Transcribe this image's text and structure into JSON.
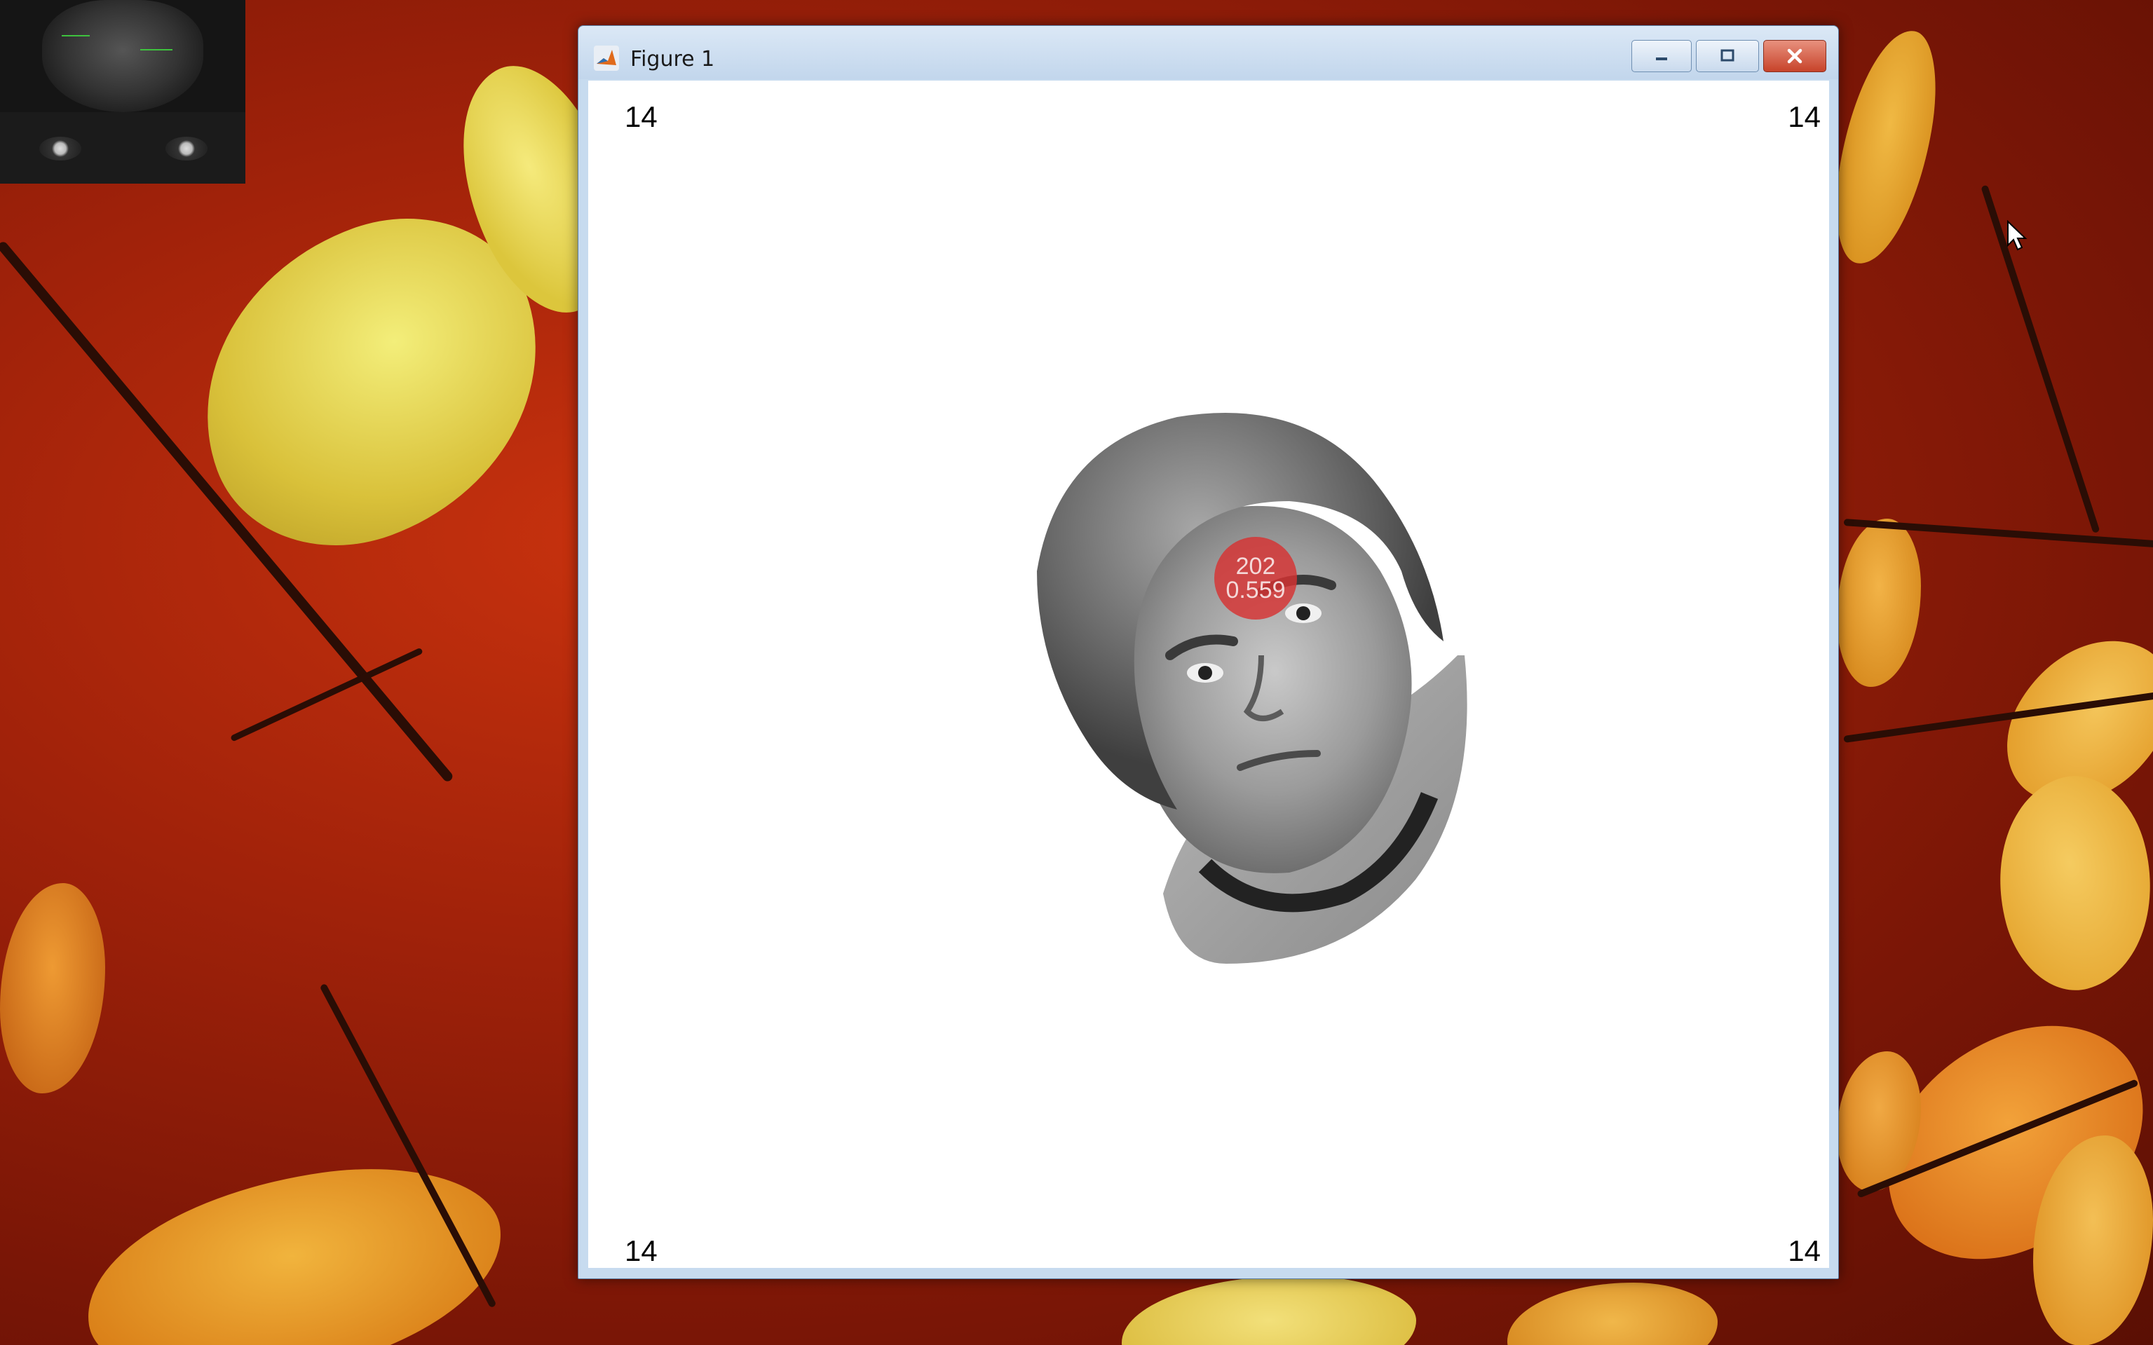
{
  "window": {
    "title": "Figure 1",
    "icon": "matlab-icon",
    "controls": [
      "minimize-icon",
      "maximize-icon",
      "close-icon"
    ]
  },
  "figure": {
    "corner_labels": {
      "top_left": "14",
      "top_right": "14",
      "bottom_left": "14",
      "bottom_right": "14"
    },
    "stimulus": "grayscale-face-photo"
  },
  "gaze_marker": {
    "line1": "202",
    "line2": "0.559",
    "color": "#d73232"
  },
  "desktop": {
    "background": "autumn-leaves-wallpaper",
    "webcam_preview": "eye-tracker-camera-view"
  },
  "colors": {
    "wallpaper_red": "#a1220a",
    "leaf_yellow": "#e8d24a",
    "leaf_orange": "#e89a2a",
    "titlebar": "#c7dbef"
  }
}
